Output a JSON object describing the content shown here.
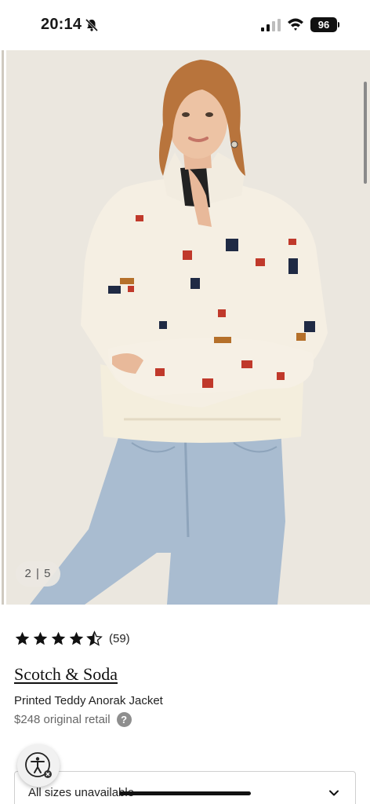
{
  "status_bar": {
    "time": "20:14",
    "battery": "96",
    "icons": [
      "bell-off-icon",
      "signal-icon",
      "wifi-icon",
      "battery-icon"
    ]
  },
  "gallery": {
    "counter": "2 | 5"
  },
  "product": {
    "rating_count": "(59)",
    "rating_value": 4.5,
    "brand": "Scotch & Soda",
    "name": "Printed Teddy Anorak Jacket",
    "price": "$248 original retail",
    "help_icon": "?"
  },
  "size_select": {
    "value": "All sizes unavailable"
  },
  "colors": {
    "accent": "#111111",
    "muted_text": "#666666"
  }
}
